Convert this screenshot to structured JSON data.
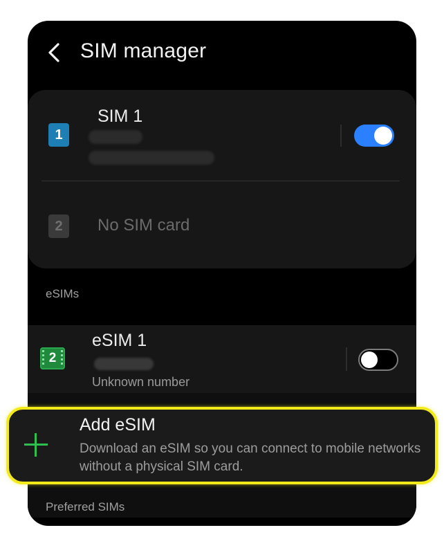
{
  "header": {
    "title": "SIM manager",
    "back_icon": "chevron-left-icon"
  },
  "physical_sims": [
    {
      "slot": "1",
      "name": "SIM 1",
      "enabled": true,
      "badge_color": "#1d7fb3",
      "detail_lines_obscured": true
    },
    {
      "slot": "2",
      "name": "No SIM card",
      "enabled": false,
      "badge_color": "#3a3a3a"
    }
  ],
  "esims_section": {
    "label": "eSIMs",
    "items": [
      {
        "slot": "2",
        "name": "eSIM 1",
        "number_text": "Unknown number",
        "enabled": false,
        "badge_color": "#1f8a3c"
      }
    ]
  },
  "add_esim": {
    "title": "Add eSIM",
    "description": "Download an eSIM so you can connect to mobile networks without a physical SIM card.",
    "icon": "plus-icon",
    "highlight_color": "#f2ea1a",
    "icon_color": "#2fbf4f"
  },
  "preferred_section": {
    "label": "Preferred SIMs"
  },
  "colors": {
    "background": "#000000",
    "card": "#171717",
    "accent_toggle": "#2b80ff"
  }
}
